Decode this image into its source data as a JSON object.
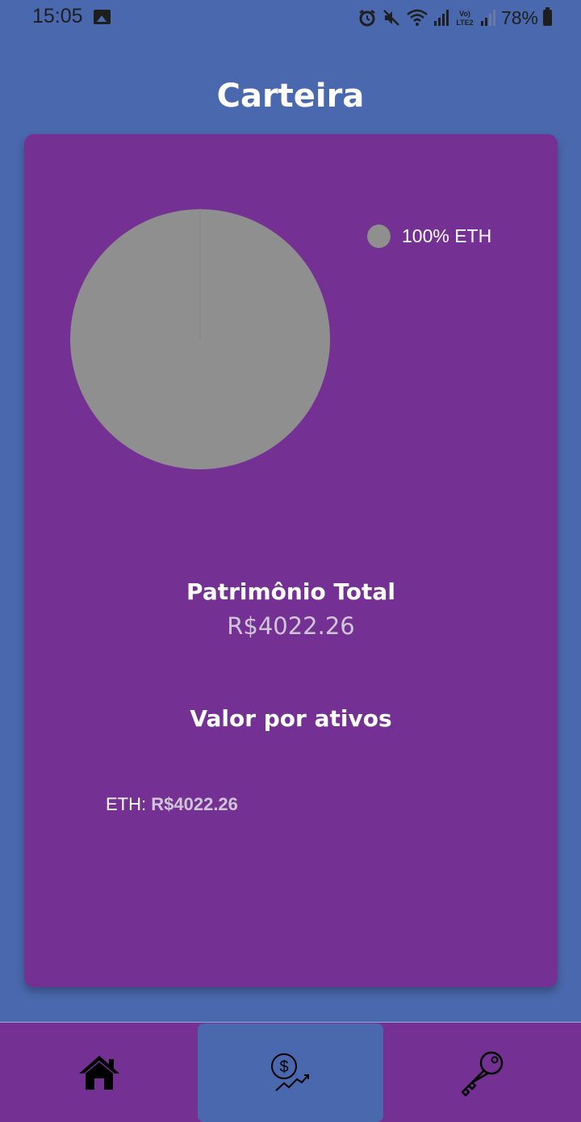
{
  "status_bar": {
    "time": "15:05",
    "battery": "78%",
    "icons": [
      "gallery-icon",
      "alarm-icon",
      "mute-icon",
      "wifi-icon",
      "signal-icon",
      "volte-lte2-icon",
      "signal-icon",
      "battery-icon"
    ]
  },
  "header": {
    "title": "Carteira"
  },
  "card": {
    "chart_data": {
      "type": "pie",
      "slices": [
        {
          "label": "ETH",
          "value": 100,
          "color": "#8f8f8f"
        }
      ],
      "legend": [
        {
          "label": "100% ETH",
          "color": "#8f8f8f"
        }
      ],
      "legend_position": "top-right"
    },
    "total_label": "Patrimônio Total",
    "total_value": "R$4022.26",
    "assets_heading": "Valor por ativos",
    "assets": [
      {
        "symbol": "ETH:",
        "value": "R$4022.26"
      }
    ]
  },
  "bottom_nav": {
    "items": [
      {
        "name": "home",
        "icon": "home-icon",
        "active": false
      },
      {
        "name": "wallet",
        "icon": "money-growth-icon",
        "active": true
      },
      {
        "name": "keys",
        "icon": "key-icon",
        "active": false
      }
    ]
  },
  "colors": {
    "background": "#4a68ad",
    "card": "#743193",
    "pie": "#8f8f8f",
    "muted_text": "#cfc5d6"
  }
}
